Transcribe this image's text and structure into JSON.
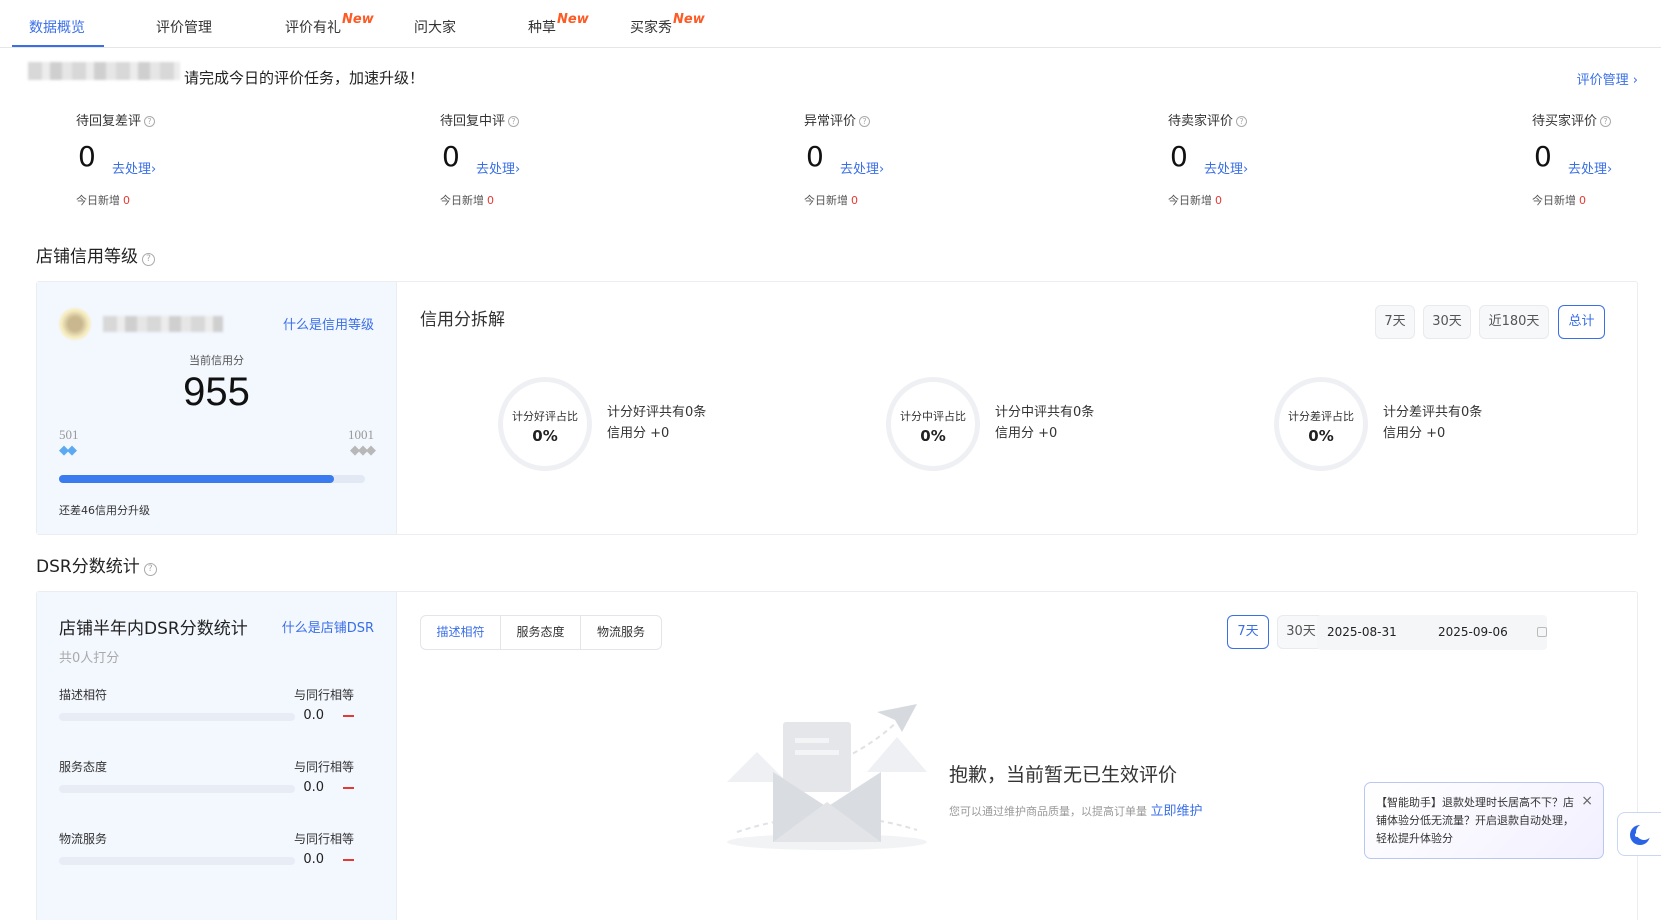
{
  "tabs": [
    {
      "label": "数据概览",
      "new": ""
    },
    {
      "label": "评价管理",
      "new": ""
    },
    {
      "label": "评价有礼",
      "new": "New"
    },
    {
      "label": "问大家",
      "new": ""
    },
    {
      "label": "种草",
      "new": "New"
    },
    {
      "label": "买家秀",
      "new": "New"
    }
  ],
  "notice": {
    "text": "请完成今日的评价任务，加速升级！",
    "link": "评价管理 ›"
  },
  "metrics": [
    {
      "label": "待回复差评",
      "value": "0",
      "link": "去处理›",
      "today_label": "今日新增",
      "today_value": "0"
    },
    {
      "label": "待回复中评",
      "value": "0",
      "link": "去处理›",
      "today_label": "今日新增",
      "today_value": "0"
    },
    {
      "label": "异常评价",
      "value": "0",
      "link": "去处理›",
      "today_label": "今日新增",
      "today_value": "0"
    },
    {
      "label": "待卖家评价",
      "value": "0",
      "link": "去处理›",
      "today_label": "今日新增",
      "today_value": "0"
    },
    {
      "label": "待买家评价",
      "value": "0",
      "link": "去处理›",
      "today_label": "今日新增",
      "today_value": "0"
    }
  ],
  "credit": {
    "section_title": "店铺信用等级",
    "what_link": "什么是信用等级",
    "current_label": "当前信用分",
    "current_score": "955",
    "range_min": "501",
    "range_max": "1001",
    "progress": 0.9,
    "upgrade_text": "还差46信用分升级",
    "breakdown_title": "信用分拆解",
    "periods": [
      "7天",
      "30天",
      "近180天",
      "总计"
    ],
    "active_period": "总计",
    "rings": [
      {
        "label": "计分好评占比",
        "pct": "0%",
        "line1": "计分好评共有0条",
        "line2": "信用分 +0"
      },
      {
        "label": "计分中评占比",
        "pct": "0%",
        "line1": "计分中评共有0条",
        "line2": "信用分 +0"
      },
      {
        "label": "计分差评占比",
        "pct": "0%",
        "line1": "计分差评共有0条",
        "line2": "信用分 +0"
      }
    ]
  },
  "dsr": {
    "section_title": "DSR分数统计",
    "card_title": "店铺半年内DSR分数统计",
    "what_link": "什么是店铺DSR",
    "count_text": "共0人打分",
    "rows": [
      {
        "name": "描述相符",
        "compare": "与同行相等",
        "value": "0.0"
      },
      {
        "name": "服务态度",
        "compare": "与同行相等",
        "value": "0.0"
      },
      {
        "name": "物流服务",
        "compare": "与同行相等",
        "value": "0.0"
      }
    ],
    "tabs": [
      "描述相符",
      "服务态度",
      "物流服务"
    ],
    "active_tab": "描述相符",
    "periods": [
      "7天",
      "30天"
    ],
    "active_period": "7天",
    "date_start": "2025-08-31",
    "date_end": "2025-09-06",
    "empty_title": "抱歉，当前暂无已生效评价",
    "empty_sub": "您可以通过维护商品质量，以提高订单量",
    "empty_link": "立即维护"
  },
  "assistant": {
    "text": "【智能助手】退款处理时长居高不下？店铺体验分低无流量？开启退款自动处理，轻松提升体验分",
    "close": "×"
  },
  "colors": {
    "accent": "#3a6fe8",
    "new_badge": "#ff5a24",
    "alert": "#e53935"
  },
  "icons": {
    "help": "help-icon",
    "calendar": "calendar-icon",
    "close": "close-icon",
    "assistant": "assistant-icon"
  }
}
